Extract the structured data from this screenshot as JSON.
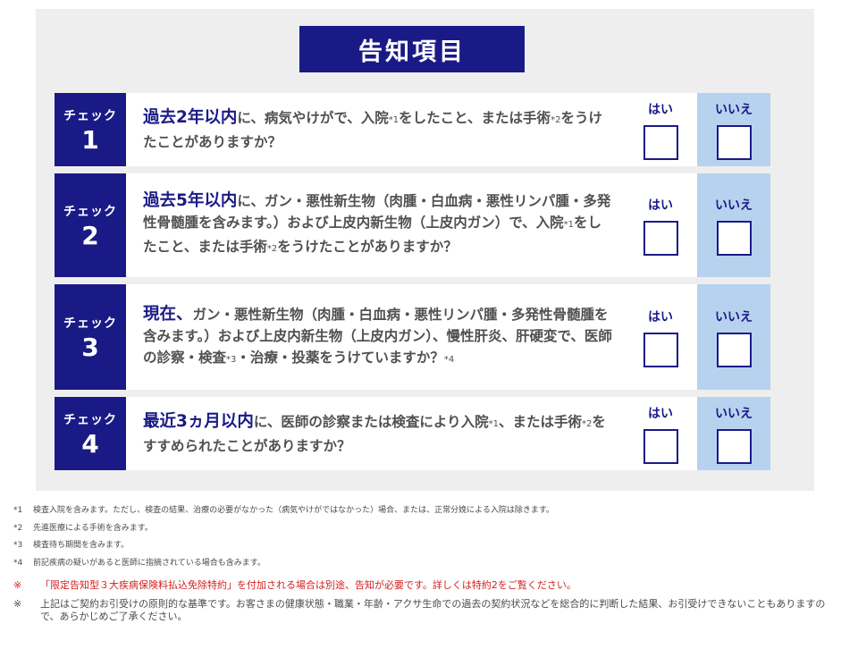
{
  "title": "告知項目",
  "yes_label": "はい",
  "no_label": "いいえ",
  "check_label": "チェック",
  "items": [
    {
      "num": "1",
      "em": "過去2年以内",
      "rest": "に、病気やけがで、入院",
      "a1": "*1",
      "rest2": "をしたこと、または手術",
      "a2": "*2",
      "rest3": "をうけたことがありますか？"
    },
    {
      "num": "2",
      "em": "過去5年以内",
      "rest": "に、ガン・悪性新生物（肉腫・白血病・悪性リンパ腫・多発性骨髄腫を含みます。）および上皮内新生物（上皮内ガン）で、入院",
      "a1": "*1",
      "rest2": "をしたこと、または手術",
      "a2": "*2",
      "rest3": "をうけたことがありますか？"
    },
    {
      "num": "3",
      "em": "現在、",
      "rest": "ガン・悪性新生物（肉腫・白血病・悪性リンパ腫・多発性骨髄腫を含みます。）および上皮内新生物（上皮内ガン）、慢性肝炎、肝硬変で、医師の診察・検査",
      "a1": "*3",
      "rest2": "・治療・投薬をうけていますか？",
      "a2": "*4",
      "rest3": ""
    },
    {
      "num": "4",
      "em": "最近3ヵ月以内",
      "rest": "に、医師の診察または検査により入院",
      "a1": "*1",
      "rest2": "、または手術",
      "a2": "*2",
      "rest3": "をすすめられたことがありますか？"
    }
  ],
  "notes": [
    {
      "mark": "*1",
      "text": "検査入院を含みます。ただし、検査の結果、治療の必要がなかった（病気やけがではなかった）場合、または、正常分娩による入院は除きます。"
    },
    {
      "mark": "*2",
      "text": "先進医療による手術を含みます。"
    },
    {
      "mark": "*3",
      "text": "検査待ち期間を含みます。"
    },
    {
      "mark": "*4",
      "text": "前記疾病の疑いがあると医師に指摘されている場合も含みます。"
    }
  ],
  "remarks": [
    {
      "mark": "※",
      "text": "「限定告知型３大疾病保険料払込免除特約」を付加される場合は別途、告知が必要です。詳しくは特約2をご覧ください。"
    },
    {
      "mark": "※",
      "text": "上記はご契約お引受けの原則的な基準です。お客さまの健康状態・職業・年齢・アクサ生命での過去の契約状況などを総合的に判断した結果、お引受けできないこともありますので、あらかじめご了承ください。"
    }
  ],
  "colors": {
    "navy": "#1a1a87",
    "no_bg": "#b7d2ee",
    "red": "#d42020",
    "panel": "#eeeeee"
  }
}
